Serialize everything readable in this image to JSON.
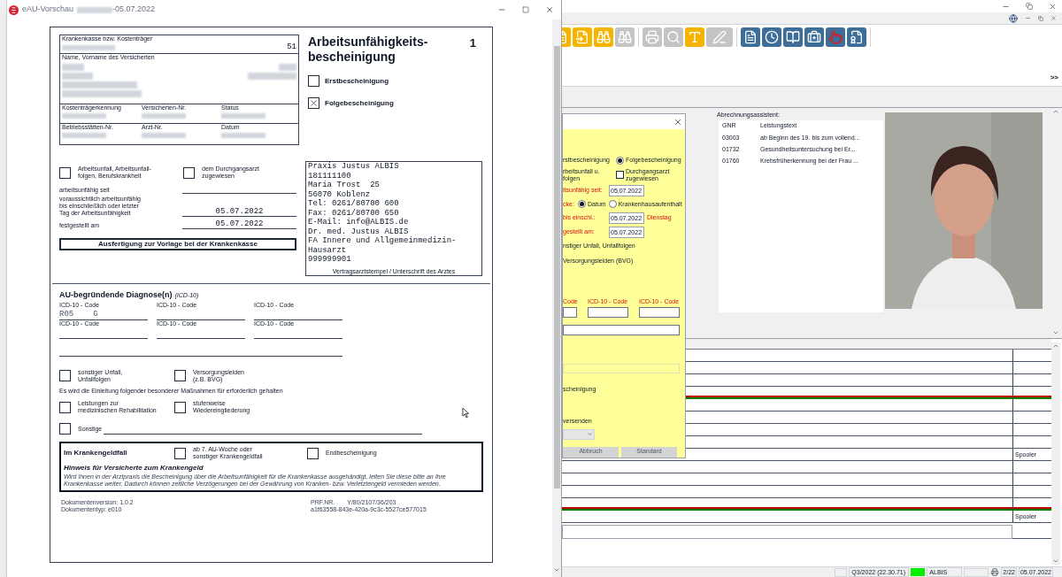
{
  "preview_window": {
    "title": "eAU-Vorschau",
    "title_suffix": "-05.07.2022"
  },
  "form": {
    "insurer_label": "Krankenkasse bzw. Kostenträger",
    "insurer_number": "51",
    "name_label": "Name, Vorname des Versicherten",
    "id_rows": [
      [
        "Kostenträgerkennung",
        "Versicherten-Nr.",
        "Status"
      ],
      [
        "Betriebsstätten-Nr.",
        "Arzt-Nr.",
        "Datum"
      ]
    ],
    "title": "Arbeitsunfähigkeits-\nbescheinigung",
    "copy_number": "1",
    "type_options": [
      {
        "label": "Erstbescheinigung",
        "checked": false
      },
      {
        "label": "Folgebescheinigung",
        "checked": true
      }
    ],
    "accident_options": [
      {
        "label": "Arbeitsunfall, Arbeitsunfall-\nfolgen, Berufskrankheit",
        "checked": false
      },
      {
        "label": "dem Durchgangsarzt\nzugewiesen",
        "checked": false
      }
    ],
    "dates": [
      {
        "label": "arbeitsunfähig seit"
      },
      {
        "label": "voraussichtlich arbeitsunfähig\nbis einschließlich oder letzter\nTag der Arbeitsunfähigkeit",
        "value": "05.07.2022"
      },
      {
        "label": "festgestellt am",
        "value": "05.07.2022"
      }
    ],
    "copy_label": "Ausfertigung zur Vorlage bei der Krankenkasse",
    "stamp_lines": [
      "Praxis Justus ALBIS",
      "181111100",
      "Maria Trost  25",
      "56070 Koblenz",
      "Tel: 0261/80700 600",
      "Fax: 0261/80700 650",
      "E-Mail: info@ALBIS.de",
      "Dr. med. Justus ALBIS",
      "FA Innere und Allgemeinmedizin-",
      "Hausarzt",
      "999999901"
    ],
    "stamp_caption": "Vertragsarztstempel / Unterschrift des Arztes",
    "diagnosis_title": "AU-begründende Diagnose(n)",
    "diagnosis_hint": "(ICD-10)",
    "codes": [
      {
        "label": "ICD-10 - Code",
        "code": "R05",
        "suffix": "G"
      },
      {
        "label": "ICD-10 - Code"
      },
      {
        "label": "ICD-10 - Code"
      },
      {
        "label": "ICD-10 - Code"
      },
      {
        "label": "ICD-10 - Code"
      },
      {
        "label": "ICD-10 - Code"
      }
    ],
    "other_options": [
      {
        "label": "sonstiger Unfall,\nUnfallfolgen",
        "checked": false
      },
      {
        "label": "Versorgungsleiden\n(z.B. BVG)",
        "checked": false
      }
    ],
    "measures_text": "Es wird die Einleitung folgender besonderer Maßnahmen für erforderlich gehalten",
    "measures": [
      {
        "label": "Leistungen zur\nmedizinischen Rehabilitation",
        "checked": false
      },
      {
        "label": "stufenweise\nWiedereingliederung",
        "checked": false
      }
    ],
    "other": {
      "label": "Sonstige",
      "checked": false
    },
    "sick_pay": {
      "title": "Im Krankengeldfall",
      "options": [
        {
          "label": "ab 7. AU-Woche oder\nsonstiger Krankengeldfall",
          "checked": false
        },
        {
          "label": "Endbescheinigung",
          "checked": false
        }
      ],
      "notice_title": "Hinweis für Versicherte zum Krankengeld",
      "notice": "Wird Ihnen in der Arztpraxis die Bescheinigung über die Arbeitsunfähigkeit für die Krankenkasse ausgehändigt, leiten Sie diese bitte an Ihre Krankenkasse weiter. Dadurch können zeitliche Verzögerungen bei der Gewährung von Kranken- bzw. Verletztengeld vermieden werden."
    },
    "footer": {
      "version": "Dokumentenversion: 1.0.2",
      "type": "Dokumententyp: e010",
      "prf_label": "PRF.NR.",
      "prf": "Y/80/2107/36/203",
      "hash": "a1f63558-843e-420a-9c3c-5527ce577015"
    }
  },
  "main_window": {
    "toolbar": [
      [
        {
          "disabled": false
        },
        {
          "disabled": false
        },
        {
          "disabled": false
        },
        {
          "disabled": true
        }
      ],
      [
        {
          "disabled": true
        },
        {
          "disabled": true
        },
        {
          "disabled": false
        },
        {
          "disabled": true
        }
      ],
      [
        {
          "disabled": false
        },
        {
          "disabled": false
        },
        {
          "disabled": false
        },
        {
          "disabled": false
        },
        {
          "disabled": false
        },
        {
          "disabled": false
        }
      ]
    ],
    "more": ">>",
    "billing": {
      "title": "Abrechnungsassistent:",
      "columns": [
        "GNR",
        "Leistungstext"
      ],
      "rows": [
        {
          "gnr": "03003",
          "text": "ab Beginn des 19. bis zum vollend..."
        },
        {
          "gnr": "01732",
          "text": "Gesundheitsuntersuchung bei Er..."
        },
        {
          "gnr": "01760",
          "text": "Krebsfrüherkennung bei der Frau ..."
        }
      ]
    },
    "journal_rows": [
      {
        "marked": false
      },
      {
        "marked": false
      },
      {
        "marked": false
      },
      {
        "marked": true
      },
      {
        "marked": false
      },
      {
        "marked": false
      },
      {
        "marked": false
      },
      {
        "marked": false
      },
      {
        "marked": false,
        "side": "Spooler"
      },
      {
        "marked": false
      },
      {
        "marked": false
      },
      {
        "marked": false
      },
      {
        "marked": true
      },
      {
        "marked": false,
        "side": "Spooler"
      }
    ],
    "status_bar": {
      "period": "Q3/2022 (22.30.71)",
      "online": true,
      "user": "ALBIS",
      "page": "2/22",
      "date": "05.07.2022"
    }
  },
  "au_dialog": {
    "first": "rstbescheinigung",
    "follow": {
      "label": "Folgebescheinigung",
      "selected": true
    },
    "accident": "rbeitsunfall u.\nfolgen",
    "transit": {
      "label": "Durchgangsarzt\nzugewiesen",
      "checked": false
    },
    "since_label": "itsunfähig seit:",
    "since": "05.07.2022",
    "until_prefix": "cke:",
    "until_modes": [
      {
        "label": "Datum",
        "selected": true
      },
      {
        "label": "Krankenhausaufenthalt",
        "selected": false
      }
    ],
    "until_label": "bis einschl.:",
    "until": "05.07.2022",
    "weekday": "Dienstag",
    "found_label": "gestellt am:",
    "found": "05.07.2022",
    "other_accident": "nstiger Unfall, Unfallfolgen",
    "pension": "Versorgungsleiden (BVG)",
    "code_labels": [
      "Code",
      "ICD-10 - Code",
      "ICD-10 - Code"
    ],
    "certificate": "scheinigung",
    "send": "versenden",
    "buttons": [
      {
        "label": "Abbruch",
        "disabled": true
      },
      {
        "label": "Standard",
        "disabled": true
      }
    ]
  }
}
